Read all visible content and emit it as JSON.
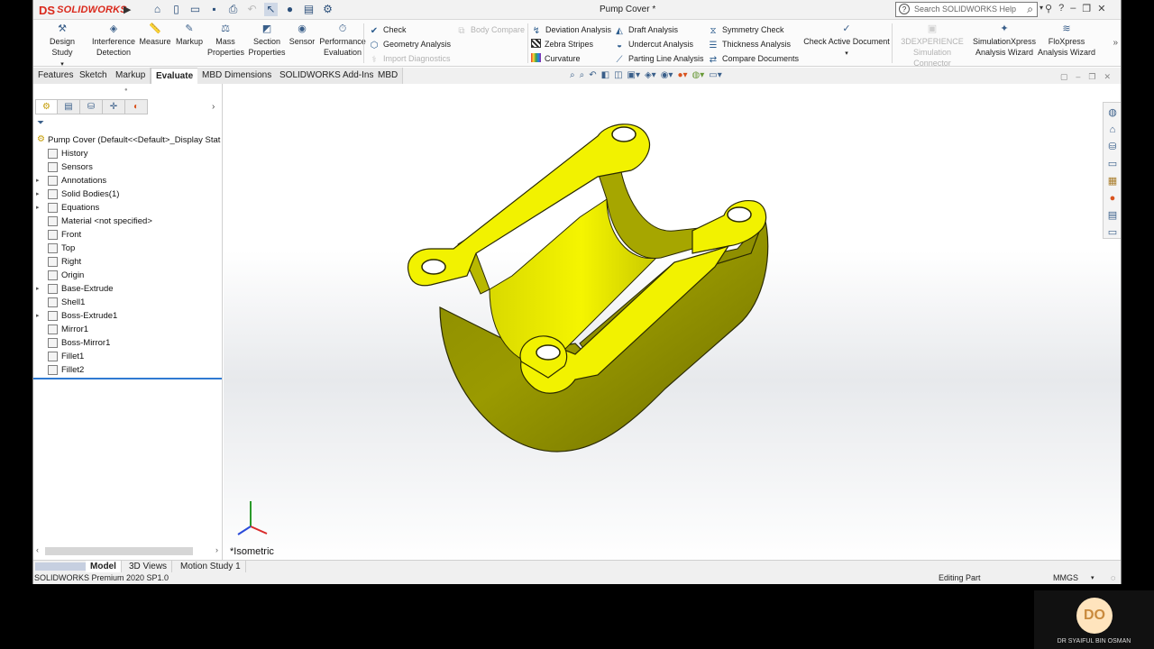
{
  "window": {
    "title": "Pump Cover *"
  },
  "logo": {
    "mark": "DS",
    "text": "SOLIDWORKS"
  },
  "quick_access": [
    "home-icon",
    "new-icon",
    "open-icon",
    "save-icon",
    "print-icon",
    "undo-icon",
    "select-icon",
    "rebuild-icon",
    "file-props-icon",
    "options-icon"
  ],
  "search": {
    "placeholder": "Search SOLIDWORKS Help",
    "help_glyph": "?"
  },
  "toolbar": {
    "design_study": "Design Study",
    "interference_detection": [
      "Interference",
      "Detection"
    ],
    "measure": "Measure",
    "markup": "Markup",
    "mass_properties": [
      "Mass",
      "Properties"
    ],
    "section_properties": [
      "Section",
      "Properties"
    ],
    "sensor": "Sensor",
    "performance_evaluation": [
      "Performance",
      "Evaluation"
    ],
    "check": "Check",
    "geometry_analysis": "Geometry Analysis",
    "import_diagnostics": "Import Diagnostics",
    "body_compare": "Body Compare",
    "deviation_analysis": "Deviation Analysis",
    "zebra_stripes": "Zebra Stripes",
    "curvature": "Curvature",
    "draft_analysis": "Draft Analysis",
    "undercut_analysis": "Undercut Analysis",
    "parting_line_analysis": "Parting Line Analysis",
    "symmetry_check": "Symmetry Check",
    "thickness_analysis": "Thickness Analysis",
    "compare_documents": "Compare Documents",
    "check_active_document": "Check Active Document",
    "experience_connector": [
      "3DEXPERIENCE",
      "Simulation Connector"
    ],
    "simulationxpress": [
      "SimulationXpress",
      "Analysis Wizard"
    ],
    "floxpress": [
      "FloXpress",
      "Analysis Wizard"
    ]
  },
  "tabs": [
    {
      "label": "Features",
      "active": false
    },
    {
      "label": "Sketch",
      "active": false
    },
    {
      "label": "Markup",
      "active": false
    },
    {
      "label": "Evaluate",
      "active": true
    },
    {
      "label": "MBD Dimensions",
      "active": false
    },
    {
      "label": "SOLIDWORKS Add-Ins",
      "active": false
    },
    {
      "label": "MBD",
      "active": false
    }
  ],
  "feature_tree": {
    "root": "Pump Cover  (Default<<Default>_Display Stat",
    "items": [
      {
        "label": "History",
        "expandable": false
      },
      {
        "label": "Sensors",
        "expandable": false
      },
      {
        "label": "Annotations",
        "expandable": true
      },
      {
        "label": "Solid Bodies(1)",
        "expandable": true
      },
      {
        "label": "Equations",
        "expandable": true
      },
      {
        "label": "Material <not specified>",
        "expandable": false
      },
      {
        "label": "Front",
        "expandable": false
      },
      {
        "label": "Top",
        "expandable": false
      },
      {
        "label": "Right",
        "expandable": false
      },
      {
        "label": "Origin",
        "expandable": false
      },
      {
        "label": "Base-Extrude",
        "expandable": true
      },
      {
        "label": "Shell1",
        "expandable": false
      },
      {
        "label": "Boss-Extrude1",
        "expandable": true
      },
      {
        "label": "Mirror1",
        "expandable": false
      },
      {
        "label": "Boss-Mirror1",
        "expandable": false
      },
      {
        "label": "Fillet1",
        "expandable": false
      },
      {
        "label": "Fillet2",
        "expandable": false
      }
    ]
  },
  "viewport": {
    "view_label": "*Isometric",
    "part_color": "#f2f200"
  },
  "bottom_tabs": [
    {
      "label": "Model",
      "active": true
    },
    {
      "label": "3D Views",
      "active": false
    },
    {
      "label": "Motion Study 1",
      "active": false
    }
  ],
  "status": {
    "product": "SOLIDWORKS Premium 2020 SP1.0",
    "mode": "Editing Part",
    "units": "MMGS"
  },
  "presenter": {
    "initials": "DO",
    "name": "DR SYAIFUL BIN OSMAN"
  }
}
